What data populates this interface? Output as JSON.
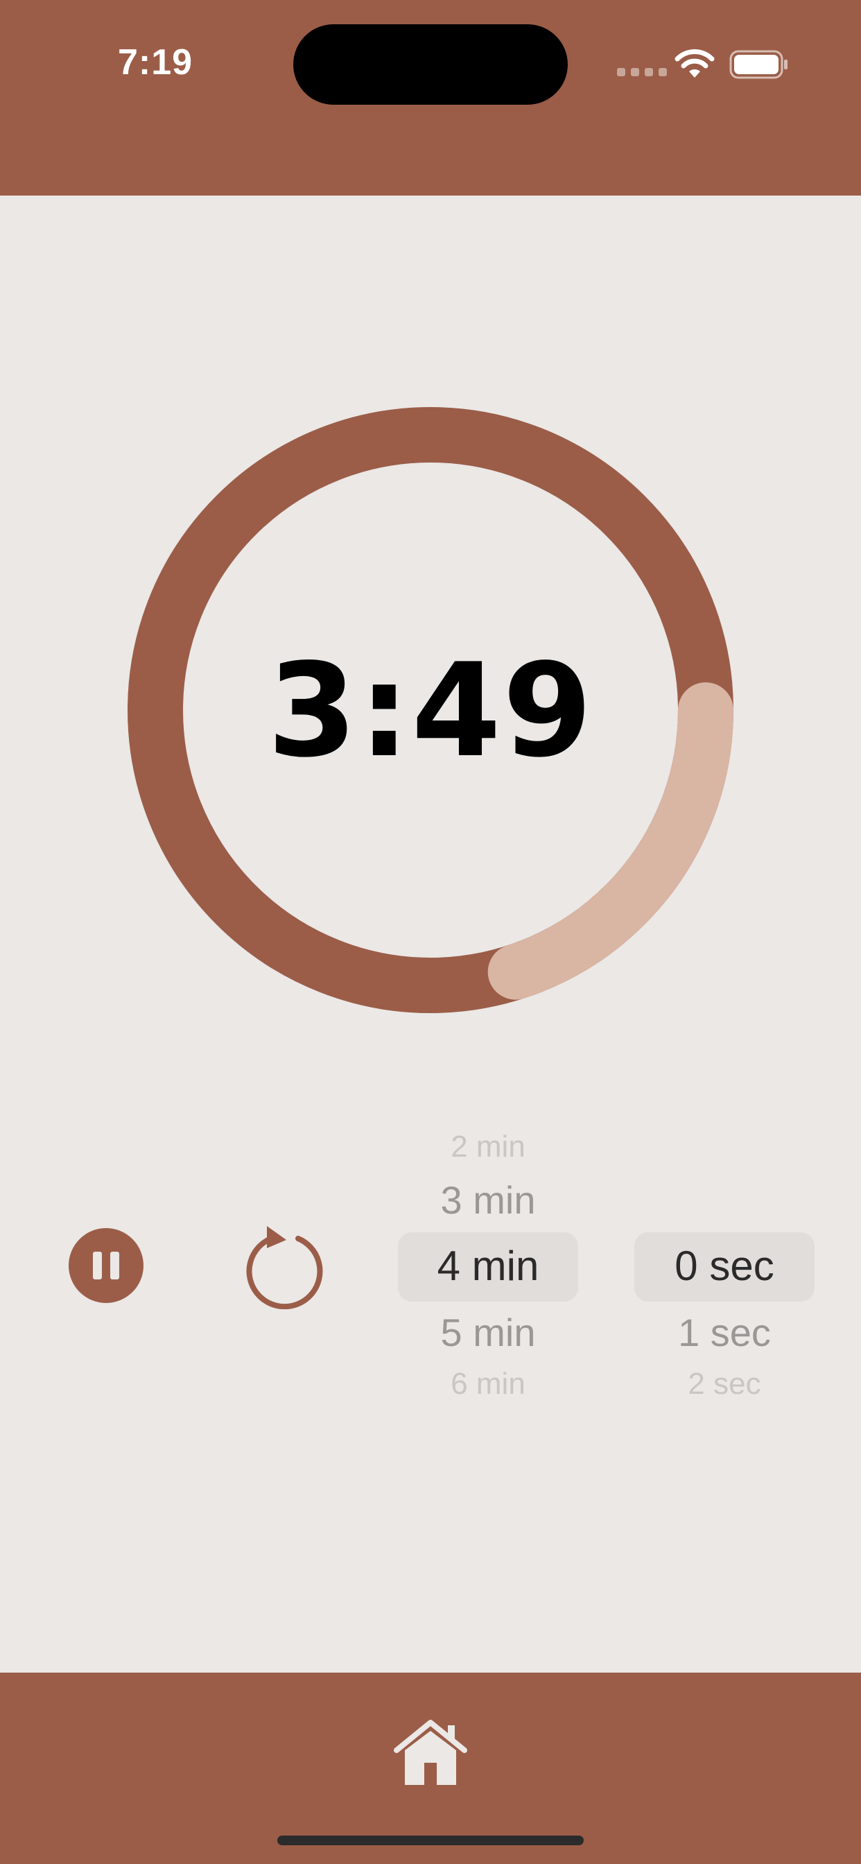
{
  "status_bar": {
    "time": "7:19"
  },
  "timer": {
    "display": "3:49",
    "remaining_fraction": 0.2
  },
  "controls": {
    "pause_icon": "pause-icon",
    "reset_icon": "reset-arrow-icon"
  },
  "minute_picker": {
    "rows": [
      "2 min",
      "3 min",
      "4 min",
      "5 min",
      "6 min"
    ],
    "selected": "4 min"
  },
  "second_picker": {
    "rows": [
      "0 sec",
      "1 sec",
      "2 sec"
    ],
    "selected": "0 sec"
  },
  "tab_bar": {
    "icon": "home-icon"
  },
  "colors": {
    "brand": "#9b5d48",
    "progress": "#d9b5a3",
    "background": "#ebe8e6"
  }
}
